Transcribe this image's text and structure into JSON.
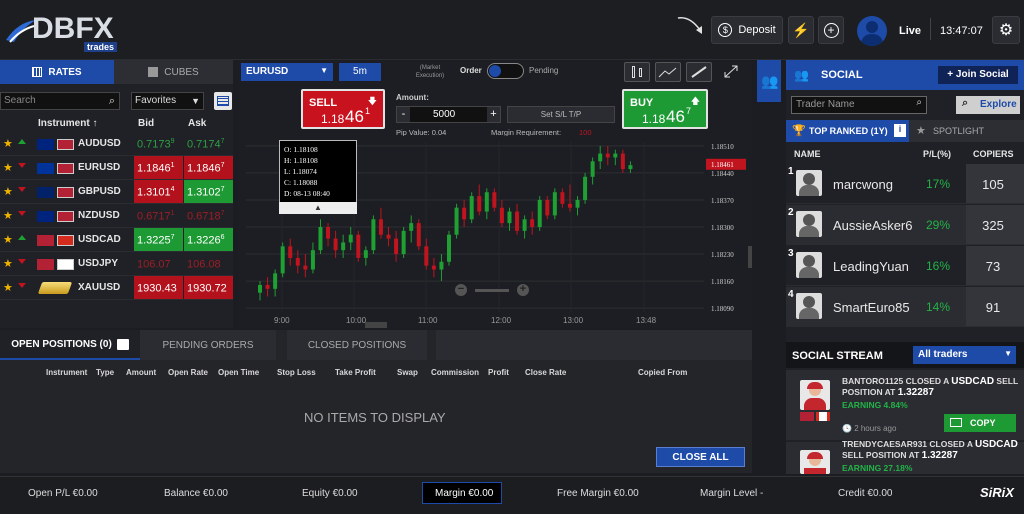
{
  "header": {
    "logo_main": "DBFX",
    "logo_sub": "trades",
    "deposit_label": "Deposit",
    "account_mode": "Live",
    "time": "13:47:07"
  },
  "rates": {
    "tab_rates": "RATES",
    "tab_cubes": "CUBES",
    "search_placeholder": "Search",
    "favorites": "Favorites",
    "col_instrument": "Instrument",
    "col_bid": "Bid",
    "col_ask": "Ask",
    "rows": [
      {
        "symbol": "AUDUSD",
        "dir": "up",
        "bid_main": "0.7173",
        "bid_sup": "9",
        "ask_main": "0.7174",
        "ask_sup": "7",
        "bid_style": "neutral",
        "ask_style": "neutral"
      },
      {
        "symbol": "EURUSD",
        "dir": "down",
        "bid_main": "1.1846",
        "bid_sup": "1",
        "ask_main": "1.1846",
        "ask_sup": "7",
        "bid_style": "red",
        "ask_style": "red"
      },
      {
        "symbol": "GBPUSD",
        "dir": "down",
        "bid_main": "1.3101",
        "bid_sup": "4",
        "ask_main": "1.3102",
        "ask_sup": "7",
        "bid_style": "red",
        "ask_style": "green"
      },
      {
        "symbol": "NZDUSD",
        "dir": "down",
        "bid_main": "0.6717",
        "bid_sup": "1",
        "ask_main": "0.6718",
        "ask_sup": "7",
        "bid_style": "neutralr",
        "ask_style": "neutralr"
      },
      {
        "symbol": "USDCAD",
        "dir": "up",
        "bid_main": "1.3225",
        "bid_sup": "7",
        "ask_main": "1.3226",
        "ask_sup": "6",
        "bid_style": "green",
        "ask_style": "green"
      },
      {
        "symbol": "USDJPY",
        "dir": "down",
        "bid_main": "106.07",
        "bid_sup": "",
        "ask_main": "106.08",
        "ask_sup": "",
        "bid_style": "neutralr",
        "ask_style": "neutralr"
      },
      {
        "symbol": "XAUUSD",
        "dir": "down",
        "bid_main": "1930.43",
        "bid_sup": "",
        "ask_main": "1930.72",
        "ask_sup": "",
        "bid_style": "red",
        "ask_style": "red"
      }
    ]
  },
  "chart": {
    "instrument": "EURUSD",
    "timeframe": "5m",
    "market_execution": "(Market Execution)",
    "order_label": "Order",
    "pending_label": "Pending",
    "sell_label": "SELL",
    "sell_price_main": "1.18",
    "sell_price_big": "46",
    "sell_price_sup": "1",
    "buy_label": "BUY",
    "buy_price_main": "1.18",
    "buy_price_big": "46",
    "buy_price_sup": "7",
    "amount_label": "Amount:",
    "amount_value": "5000",
    "set_sltp": "Set S/L T/P",
    "pip_value": "Pip Value: 0.04",
    "margin_req_label": "Margin Requirement:",
    "margin_req_value": "100",
    "tooltip": {
      "o": "O:  1.18108",
      "h": "H:  1.18108",
      "l": "L:  1.18074",
      "c": "C:  1.18088",
      "d": "D:  08-13 08:40"
    },
    "current_price": "1.18461",
    "y_ticks": [
      "1.18510",
      "1.18440",
      "1.18370",
      "1.18300",
      "1.18230",
      "1.18160",
      "1.18090"
    ],
    "x_ticks": [
      "9:00",
      "10:00",
      "11:00",
      "12:00",
      "13:00",
      "13:48"
    ]
  },
  "chart_data": {
    "type": "candlestick",
    "instrument": "EURUSD",
    "interval": "5m",
    "ylim": [
      1.1808,
      1.1852
    ],
    "x_ticks": [
      "9:00",
      "10:00",
      "11:00",
      "12:00",
      "13:00",
      "13:48"
    ],
    "candles": [
      [
        1.1813,
        1.1816,
        1.1811,
        1.1815
      ],
      [
        1.1815,
        1.1817,
        1.1812,
        1.1814
      ],
      [
        1.1814,
        1.1819,
        1.1812,
        1.1818
      ],
      [
        1.1818,
        1.1826,
        1.1817,
        1.1825
      ],
      [
        1.1825,
        1.1827,
        1.182,
        1.1822
      ],
      [
        1.1822,
        1.1824,
        1.1818,
        1.182
      ],
      [
        1.182,
        1.1823,
        1.1817,
        1.1819
      ],
      [
        1.1819,
        1.1826,
        1.1818,
        1.1824
      ],
      [
        1.1824,
        1.1832,
        1.1823,
        1.183
      ],
      [
        1.183,
        1.1831,
        1.1825,
        1.1827
      ],
      [
        1.1827,
        1.1829,
        1.1822,
        1.1824
      ],
      [
        1.1824,
        1.1828,
        1.1822,
        1.1826
      ],
      [
        1.1826,
        1.183,
        1.1824,
        1.1828
      ],
      [
        1.1828,
        1.1829,
        1.1821,
        1.1822
      ],
      [
        1.1822,
        1.1825,
        1.182,
        1.1824
      ],
      [
        1.1824,
        1.1833,
        1.1823,
        1.1832
      ],
      [
        1.1832,
        1.1835,
        1.1827,
        1.1828
      ],
      [
        1.1828,
        1.183,
        1.1825,
        1.1827
      ],
      [
        1.1827,
        1.1829,
        1.1821,
        1.1823
      ],
      [
        1.1823,
        1.183,
        1.1822,
        1.1829
      ],
      [
        1.1829,
        1.1833,
        1.1826,
        1.1831
      ],
      [
        1.1831,
        1.1832,
        1.1824,
        1.1825
      ],
      [
        1.1825,
        1.1827,
        1.1819,
        1.182
      ],
      [
        1.182,
        1.1822,
        1.1817,
        1.1819
      ],
      [
        1.1819,
        1.1823,
        1.1816,
        1.1821
      ],
      [
        1.1821,
        1.1829,
        1.182,
        1.1828
      ],
      [
        1.1828,
        1.1836,
        1.1827,
        1.1835
      ],
      [
        1.1835,
        1.1837,
        1.183,
        1.1832
      ],
      [
        1.1832,
        1.1839,
        1.1831,
        1.1838
      ],
      [
        1.1838,
        1.1841,
        1.1833,
        1.1834
      ],
      [
        1.1834,
        1.184,
        1.1832,
        1.1839
      ],
      [
        1.1839,
        1.184,
        1.1834,
        1.1835
      ],
      [
        1.1835,
        1.1837,
        1.183,
        1.1831
      ],
      [
        1.1831,
        1.1835,
        1.1829,
        1.1834
      ],
      [
        1.1834,
        1.1836,
        1.1828,
        1.1829
      ],
      [
        1.1829,
        1.1833,
        1.1827,
        1.1832
      ],
      [
        1.1832,
        1.1834,
        1.1828,
        1.183
      ],
      [
        1.183,
        1.1838,
        1.1829,
        1.1837
      ],
      [
        1.1837,
        1.1838,
        1.1832,
        1.1833
      ],
      [
        1.1833,
        1.184,
        1.1832,
        1.1839
      ],
      [
        1.1839,
        1.184,
        1.1835,
        1.1836
      ],
      [
        1.1836,
        1.1841,
        1.1834,
        1.1835
      ],
      [
        1.1835,
        1.1838,
        1.1833,
        1.1837
      ],
      [
        1.1837,
        1.1844,
        1.1836,
        1.1843
      ],
      [
        1.1843,
        1.1848,
        1.1841,
        1.1847
      ],
      [
        1.1847,
        1.1851,
        1.1845,
        1.1849
      ],
      [
        1.1849,
        1.1851,
        1.1846,
        1.1848
      ],
      [
        1.1848,
        1.185,
        1.1846,
        1.1849
      ],
      [
        1.1849,
        1.185,
        1.1844,
        1.1845
      ],
      [
        1.1845,
        1.1847,
        1.1844,
        1.1846
      ]
    ]
  },
  "positions": {
    "tab_open": "OPEN POSITIONS (0)",
    "tab_pending": "PENDING ORDERS",
    "tab_closed": "CLOSED POSITIONS",
    "columns": [
      "Instrument",
      "Type",
      "Amount",
      "Open Rate",
      "Open Time",
      "Stop Loss",
      "Take Profit",
      "Swap",
      "Commission",
      "Profit",
      "Close Rate",
      "Copied From"
    ],
    "empty_text": "NO ITEMS TO DISPLAY",
    "close_all": "CLOSE ALL"
  },
  "social": {
    "title": "SOCIAL",
    "join": "+ Join Social",
    "search_placeholder": "Trader Name",
    "explore": "Explore",
    "tab_top": "TOP RANKED (1Y)",
    "tab_spotlight": "SPOTLIGHT",
    "col_name": "NAME",
    "col_pl": "P/L(%)",
    "col_copiers": "COPIERS",
    "traders": [
      {
        "rank": "1",
        "name": "marcwong",
        "pl": "17%",
        "copiers": "105"
      },
      {
        "rank": "2",
        "name": "AussieAsker6",
        "pl": "29%",
        "copiers": "325"
      },
      {
        "rank": "3",
        "name": "LeadingYuan",
        "pl": "16%",
        "copiers": "73"
      },
      {
        "rank": "4",
        "name": "SmartEuro85",
        "pl": "14%",
        "copiers": "91"
      }
    ],
    "stream_title": "SOCIAL STREAM",
    "stream_filter": "All traders",
    "stream_items": [
      {
        "text_a": "BANTORO1125 CLOSED A ",
        "sym": "USDCAD",
        "text_b": " SELL POSITION AT ",
        "price": "1.32287",
        "earning": "EARNING 4.84%",
        "time": "2 hours ago",
        "copy": "COPY"
      },
      {
        "text_a": "TRENDYCAESAR931 CLOSED A ",
        "sym": "USDCAD",
        "text_b": " SELL POSITION AT ",
        "price": "1.32287",
        "earning": "EARNING 27.18%"
      }
    ]
  },
  "footer": {
    "open_pl": "Open P/L €0.00",
    "balance": "Balance €0.00",
    "equity": "Equity €0.00",
    "margin": "Margin €0.00",
    "free_margin": "Free Margin €0.00",
    "margin_level": "Margin Level -",
    "credit": "Credit €0.00",
    "brand": "SiRiX"
  }
}
